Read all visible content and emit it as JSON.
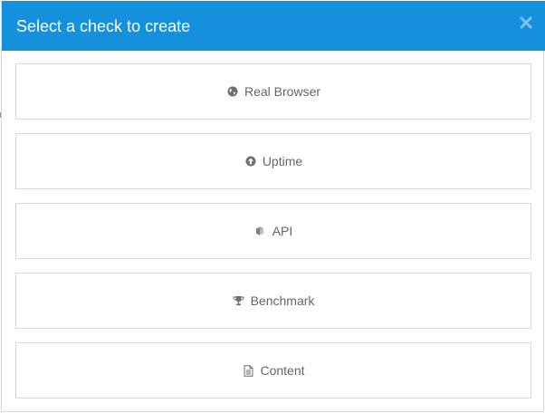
{
  "modal": {
    "title": "Select a check to create",
    "close_icon": "close-icon",
    "header_color": "#1590dd"
  },
  "options": [
    {
      "label": "Real Browser",
      "icon": "globe-icon"
    },
    {
      "label": "Uptime",
      "icon": "arrow-up-circle-icon"
    },
    {
      "label": "API",
      "icon": "cubes-icon"
    },
    {
      "label": "Benchmark",
      "icon": "trophy-icon"
    },
    {
      "label": "Content",
      "icon": "document-icon"
    }
  ]
}
